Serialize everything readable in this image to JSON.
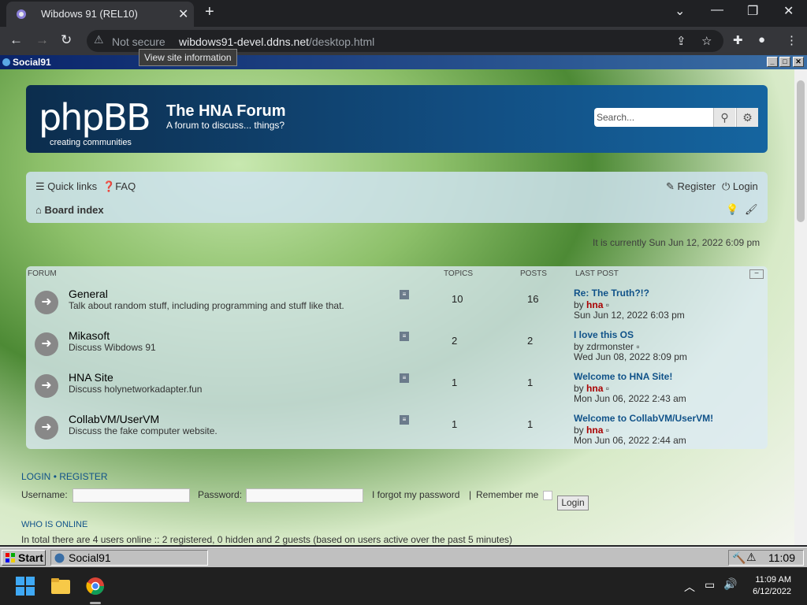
{
  "browser": {
    "tab_title": "Wibdows 91 (REL10)",
    "not_secure": "Not secure",
    "url_domain": "wibdows91-devel.ddns.net",
    "url_path": "/desktop.html",
    "tooltip": "View site information"
  },
  "win91": {
    "window_title": "Social91",
    "start_label": "Start",
    "task_item": "Social91",
    "clock": "11:09"
  },
  "forum": {
    "logo_text": "phpBB",
    "logo_sub": "creating communities",
    "site_name": "The HNA Forum",
    "site_desc": "A forum to discuss... things?",
    "search_placeholder": "Search...",
    "nav": {
      "quick_links": "Quick links",
      "faq": "FAQ",
      "register": "Register",
      "login": "Login",
      "board_index": "Board index"
    },
    "current_time": "It is currently Sun Jun 12, 2022 6:09 pm",
    "headers": {
      "forum": "FORUM",
      "topics": "TOPICS",
      "posts": "POSTS",
      "last_post": "LAST POST"
    },
    "forums": [
      {
        "name": "General",
        "desc": "Talk about random stuff, including programming and stuff like that.",
        "topics": "10",
        "posts": "16",
        "last_title": "Re: The Truth?!?",
        "by": "by",
        "user": "hna",
        "date": "Sun Jun 12, 2022 6:03 pm"
      },
      {
        "name": "Mikasoft",
        "desc": "Discuss Wibdows 91",
        "topics": "2",
        "posts": "2",
        "last_title": "I love this OS",
        "by": "by",
        "user": "zdrmonster",
        "date": "Wed Jun 08, 2022 8:09 pm"
      },
      {
        "name": "HNA Site",
        "desc": "Discuss holynetworkadapter.fun",
        "topics": "1",
        "posts": "1",
        "last_title": "Welcome to HNA Site!",
        "by": "by",
        "user": "hna",
        "date": "Mon Jun 06, 2022 2:43 am"
      },
      {
        "name": "CollabVM/UserVM",
        "desc": "Discuss the fake computer website.",
        "topics": "1",
        "posts": "1",
        "last_title": "Welcome to CollabVM/UserVM!",
        "by": "by",
        "user": "hna",
        "date": "Mon Jun 06, 2022 2:44 am"
      }
    ],
    "login_section": {
      "heading_login": "LOGIN",
      "sep": "•",
      "heading_register": "REGISTER",
      "username_label": "Username:",
      "password_label": "Password:",
      "forgot": "I forgot my password",
      "pipe": "|",
      "remember": "Remember me",
      "login_button": "Login",
      "who_online": "WHO IS ONLINE",
      "online_text": "In total there are 4 users online :: 2 registered, 0 hidden and 2 guests (based on users active over the past 5 minutes)"
    }
  },
  "system_tray": {
    "time": "11:09 AM",
    "date": "6/12/2022"
  }
}
